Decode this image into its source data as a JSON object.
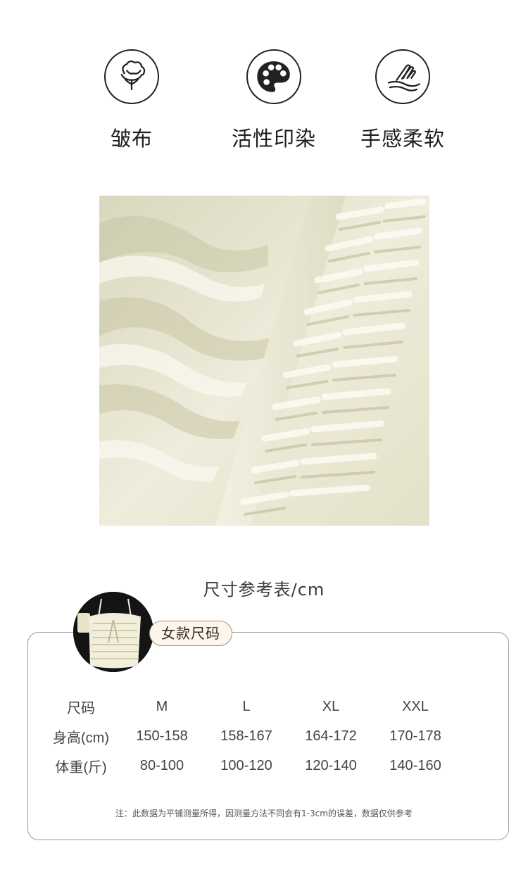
{
  "features": [
    {
      "icon": "cotton-icon",
      "label": "皱布"
    },
    {
      "icon": "palette-icon",
      "label": "活性印染"
    },
    {
      "icon": "soft-touch-icon",
      "label": "手感柔软"
    }
  ],
  "fabric_image": {
    "icon": "fabric-closeup-image"
  },
  "size_chart": {
    "title": "尺寸参考表/cm",
    "tag": "女款尺码",
    "header": [
      "尺码",
      "M",
      "L",
      "XL",
      "XXL"
    ],
    "rows": [
      [
        "身高(cm)",
        "150-158",
        "158-167",
        "164-172",
        "170-178"
      ],
      [
        "体重(斤)",
        "80-100",
        "100-120",
        "120-140",
        "140-160"
      ]
    ],
    "note": "注：此数据为平铺测量所得，因测量方法不同会有1-3cm的误差，数据仅供参考"
  },
  "colors": {
    "accent": "#b08e6a",
    "fabric": "#ebe8d4"
  }
}
